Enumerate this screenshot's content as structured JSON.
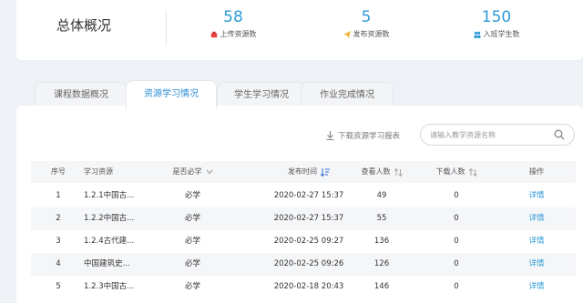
{
  "overview": {
    "title": "总体概况",
    "stats": [
      {
        "value": "58",
        "label": "上传资源数",
        "icon": "upload-box-icon",
        "color": "#e8413c"
      },
      {
        "value": "5",
        "label": "发布资源数",
        "icon": "paper-plane-icon",
        "color": "#f2b230"
      },
      {
        "value": "150",
        "label": "入班学生数",
        "icon": "users-icon",
        "color": "#2e9bd6"
      }
    ]
  },
  "tabs": [
    {
      "label": "课程数据概况",
      "active": false
    },
    {
      "label": "资源学习情况",
      "active": true
    },
    {
      "label": "学生学习情况",
      "active": false
    },
    {
      "label": "作业完成情况",
      "active": false
    }
  ],
  "toolbar": {
    "download_label": "下载资源学习报表",
    "search_placeholder": "请输入教学资源名称"
  },
  "table": {
    "headers": {
      "no": "序号",
      "name": "学习资源",
      "required": "是否必学",
      "time": "发布时间",
      "views": "查看人数",
      "downloads": "下载人数",
      "action": "操作"
    },
    "rows": [
      {
        "no": "1",
        "name": "1.2.1中国古...",
        "required": "必学",
        "time": "2020-02-27 15:37",
        "views": "49",
        "downloads": "0",
        "action": "详情"
      },
      {
        "no": "2",
        "name": "1.2.2中国古...",
        "required": "必学",
        "time": "2020-02-27 15:37",
        "views": "55",
        "downloads": "0",
        "action": "详情"
      },
      {
        "no": "3",
        "name": "1.2.4古代建...",
        "required": "必学",
        "time": "2020-02-25 09:27",
        "views": "136",
        "downloads": "0",
        "action": "详情"
      },
      {
        "no": "4",
        "name": "中国建筑史...",
        "required": "必学",
        "time": "2020-02-25 09:26",
        "views": "126",
        "downloads": "0",
        "action": "详情"
      },
      {
        "no": "5",
        "name": "1.2.3中国古...",
        "required": "必学",
        "time": "2020-02-18 20:43",
        "views": "146",
        "downloads": "0",
        "action": "详情"
      }
    ]
  },
  "colors": {
    "accent": "#2e9bd6",
    "sort_active": "#2e6fd6"
  }
}
